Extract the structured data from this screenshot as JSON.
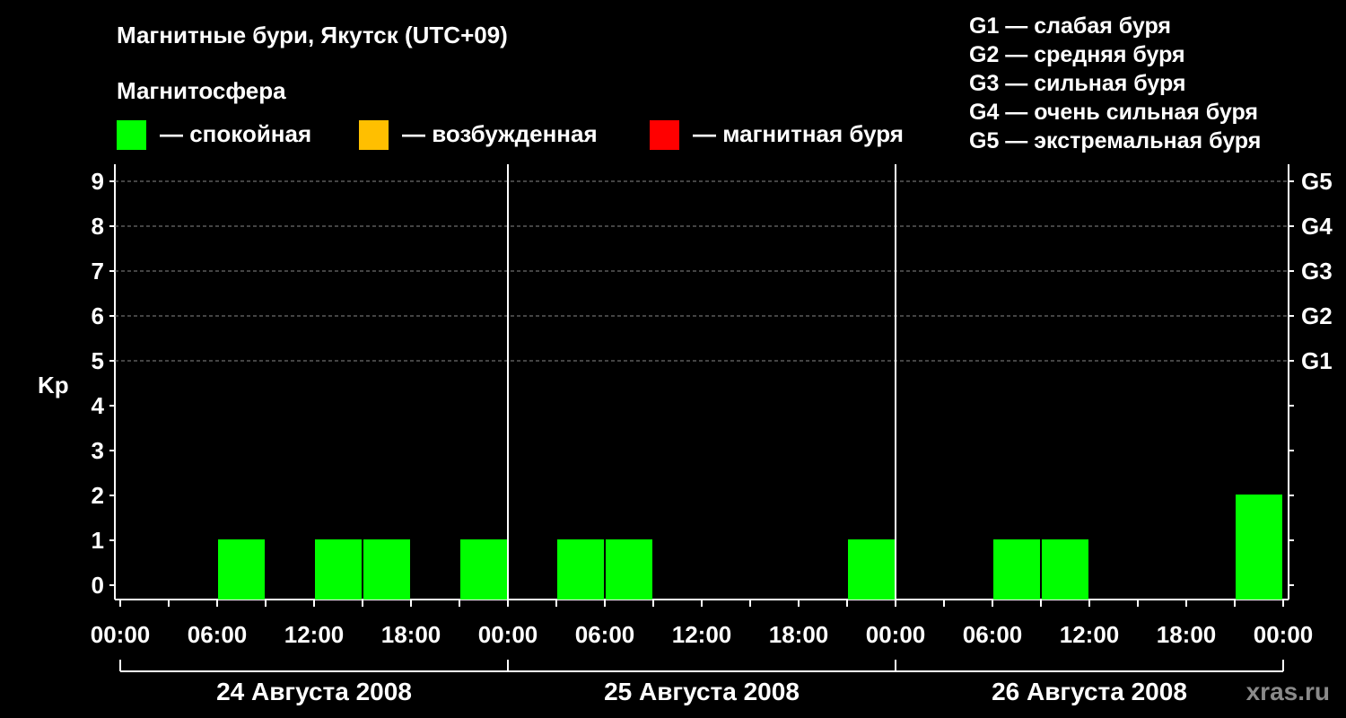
{
  "title": "Магнитные бури, Якутск (UTC+09)",
  "legend": {
    "heading": "Магнитосфера",
    "items": [
      {
        "label": "— спокойная",
        "color": "#00ff00"
      },
      {
        "label": "— возбужденная",
        "color": "#ffbf00"
      },
      {
        "label": "— магнитная буря",
        "color": "#ff0000"
      }
    ]
  },
  "g_legend": [
    "G1 — слабая буря",
    "G2 — средняя буря",
    "G3 — сильная буря",
    "G4 — очень сильная буря",
    "G5 — экстремальная буря"
  ],
  "watermark": "xras.ru",
  "chart_data": {
    "type": "bar",
    "ylabel": "Kp",
    "ylim": [
      0,
      9
    ],
    "y_ticks": [
      "0",
      "1",
      "2",
      "3",
      "4",
      "5",
      "6",
      "7",
      "8",
      "9"
    ],
    "right_ticks": [
      {
        "kp": 5,
        "label": "G1"
      },
      {
        "kp": 6,
        "label": "G2"
      },
      {
        "kp": 7,
        "label": "G3"
      },
      {
        "kp": 8,
        "label": "G4"
      },
      {
        "kp": 9,
        "label": "G5"
      }
    ],
    "x_tick_labels": [
      "00:00",
      "06:00",
      "12:00",
      "18:00",
      "00:00",
      "06:00",
      "12:00",
      "18:00",
      "00:00",
      "06:00",
      "12:00",
      "18:00",
      "00:00"
    ],
    "days": [
      "24 Августа 2008",
      "25 Августа 2008",
      "26 Августа 2008"
    ],
    "x_unit": "3-hour intervals",
    "values": [
      0,
      0,
      1,
      0,
      1,
      1,
      0,
      1,
      0,
      1,
      1,
      0,
      0,
      0,
      0,
      1,
      0,
      0,
      1,
      1,
      0,
      0,
      0,
      2
    ],
    "bar_color": "#00ff00",
    "grid": "dashed horizontal at Kp 5–9"
  }
}
